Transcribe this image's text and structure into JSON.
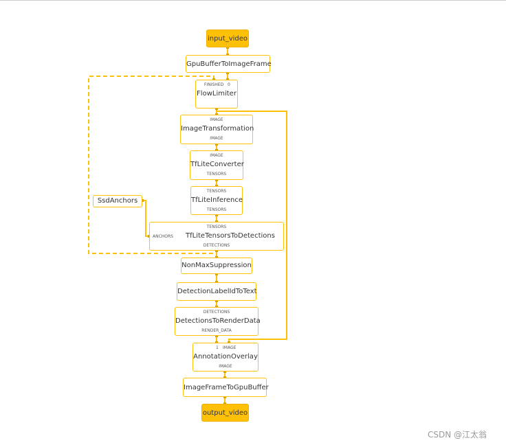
{
  "colors": {
    "edge": "#ffc107",
    "port": "#d9a000",
    "io_fill": "#ffc107"
  },
  "nodes": {
    "input_video": "input_video",
    "gpu_to_image": "GpuBufferToImageFrame",
    "flow_limiter": "FlowLimiter",
    "image_transformation": "ImageTransformation",
    "tflite_converter": "TfLiteConverter",
    "tflite_inference": "TfLiteInference",
    "ssd_anchors": "SsdAnchors",
    "tensors_to_detections": "TfLiteTensorsToDetections",
    "nms": "NonMaxSuppression",
    "label_to_text": "DetectionLabelIdToText",
    "detections_to_render": "DetectionsToRenderData",
    "annotation_overlay": "AnnotationOverlay",
    "image_to_gpu": "ImageFrameToGpuBuffer",
    "output_video": "output_video"
  },
  "ports": {
    "flow_finished": "FINISHED",
    "flow_0": "0",
    "it_in": "IMAGE",
    "it_out": "IMAGE",
    "conv_in": "IMAGE",
    "conv_out": "TENSORS",
    "inf_in": "TENSORS",
    "inf_out": "TENSORS",
    "ttd_in": "TENSORS",
    "ttd_anchors": "ANCHORS",
    "ttd_out": "DETECTIONS",
    "dtr_in": "DETECTIONS",
    "dtr_out": "RENDER_DATA",
    "ao_1": "1",
    "ao_image": "IMAGE",
    "ao_out": "IMAGE"
  },
  "watermark": "CSDN @江太翁"
}
